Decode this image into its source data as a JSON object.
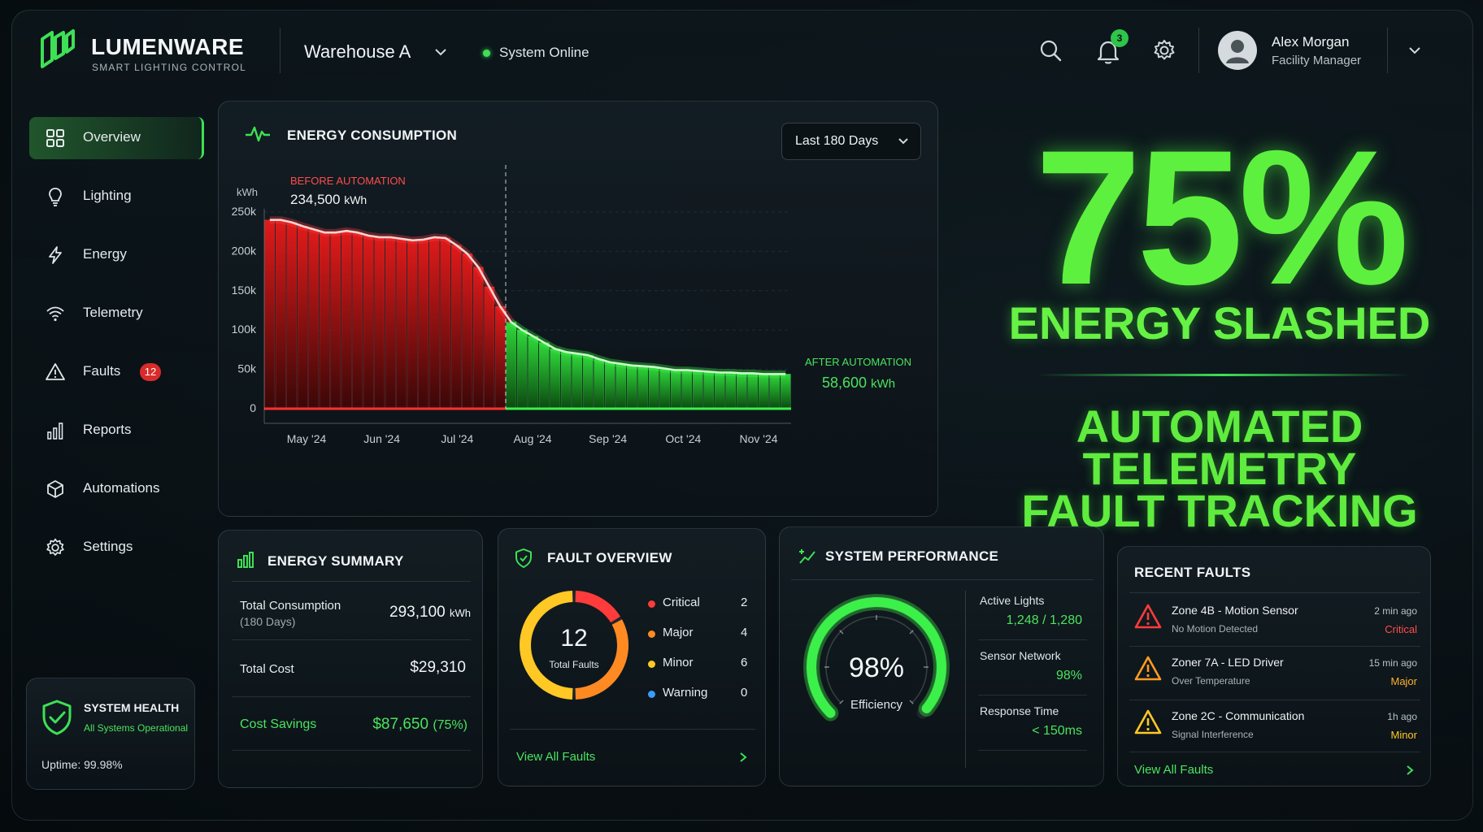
{
  "brand": {
    "name": "LUMENWARE",
    "subtitle": "SMART LIGHTING CONTROL"
  },
  "topbar": {
    "location": "Warehouse A",
    "status": "System Online",
    "notifications_count": "3",
    "user_name": "Alex Morgan",
    "user_role": "Facility Manager"
  },
  "sidebar": {
    "items": [
      {
        "label": "Overview",
        "icon": "grid-icon"
      },
      {
        "label": "Lighting",
        "icon": "bulb-icon"
      },
      {
        "label": "Energy",
        "icon": "bolt-icon"
      },
      {
        "label": "Telemetry",
        "icon": "wifi-icon"
      },
      {
        "label": "Faults",
        "icon": "warning-icon",
        "badge": "12"
      },
      {
        "label": "Reports",
        "icon": "bars-icon"
      },
      {
        "label": "Automations",
        "icon": "cube-icon"
      },
      {
        "label": "Settings",
        "icon": "gear-icon"
      }
    ],
    "health": {
      "title": "SYSTEM HEALTH",
      "status": "All Systems Operational",
      "uptime": "Uptime: 99.98%"
    }
  },
  "energy_chart": {
    "title": "ENERGY CONSUMPTION",
    "range": "Last 180 Days",
    "before_label": "BEFORE AUTOMATION",
    "before_value": "234,500",
    "after_label": "AFTER AUTOMATION",
    "after_value": "58,600",
    "unit": "kWh"
  },
  "chart_data": {
    "type": "area",
    "ylabel": "kWh",
    "ylim": [
      0,
      250000
    ],
    "yticks": [
      "250k",
      "200k",
      "150k",
      "100k",
      "50k",
      "0"
    ],
    "xticks": [
      "May '24",
      "Jun '24",
      "Jul '24",
      "Aug '24",
      "Sep '24",
      "Oct '24",
      "Nov '24"
    ],
    "series": [
      {
        "values": [
          240000,
          240000,
          237000,
          232000,
          228000,
          224000,
          224000,
          226000,
          224000,
          220000,
          218000,
          218000,
          216000,
          214000,
          215000,
          218000,
          217000,
          208000,
          197000,
          180000,
          155000,
          130000,
          110000,
          100000,
          92000,
          84000,
          76000,
          72000,
          70000,
          68000,
          63000,
          59000,
          57000,
          55000,
          54000,
          53000,
          51000,
          49000,
          49000,
          48000,
          47000,
          46000,
          46000,
          45000,
          45000,
          44000,
          44000,
          44000
        ]
      }
    ],
    "automation_start_index": 22,
    "colors": {
      "before": "#ff2a2a",
      "after": "#3cf04a"
    }
  },
  "hero": {
    "percent": "75%",
    "headline": "ENERGY SLASHED",
    "line1": "AUTOMATED",
    "line2": "TELEMETRY",
    "line3": "FAULT TRACKING"
  },
  "summary": {
    "title": "ENERGY SUMMARY",
    "total_consumption_label": "Total Consumption",
    "total_consumption_period": "(180 Days)",
    "total_consumption_value": "293,100",
    "total_consumption_unit": "kWh",
    "total_cost_label": "Total Cost",
    "total_cost_value": "$29,310",
    "savings_label": "Cost Savings",
    "savings_value": "$87,650",
    "savings_pct": "(75%)"
  },
  "faults": {
    "title": "FAULT OVERVIEW",
    "total": "12",
    "total_label": "Total Faults",
    "rows": [
      {
        "label": "Critical",
        "count": "2",
        "color": "#ff3b3b"
      },
      {
        "label": "Major",
        "count": "4",
        "color": "#ff8a22"
      },
      {
        "label": "Minor",
        "count": "6",
        "color": "#ffc825"
      },
      {
        "label": "Warning",
        "count": "0",
        "color": "#3a9cff"
      }
    ],
    "link": "View All Faults"
  },
  "performance": {
    "title": "SYSTEM PERFORMANCE",
    "efficiency_value": "98%",
    "efficiency_label": "Efficiency",
    "efficiency_fraction": 0.98,
    "active_lights_label": "Active Lights",
    "active_lights_value": "1,248 / 1,280",
    "sensor_label": "Sensor Network",
    "sensor_value": "98%",
    "response_label": "Response Time",
    "response_value": "< 150ms"
  },
  "recent_faults": {
    "title": "RECENT FAULTS",
    "items": [
      {
        "name": "Zone 4B - Motion Sensor",
        "detail": "No Motion Detected",
        "time": "2 min ago",
        "severity": "Critical",
        "color": "#ff3b3b"
      },
      {
        "name": "Zoner 7A - LED Driver",
        "detail": "Over Temperature",
        "time": "15 min ago",
        "severity": "Major",
        "color": "#ff9a22"
      },
      {
        "name": "Zone 2C - Communication",
        "detail": "Signal Interference",
        "time": "1h ago",
        "severity": "Minor",
        "color": "#ffc825"
      }
    ],
    "link": "View All Faults"
  }
}
